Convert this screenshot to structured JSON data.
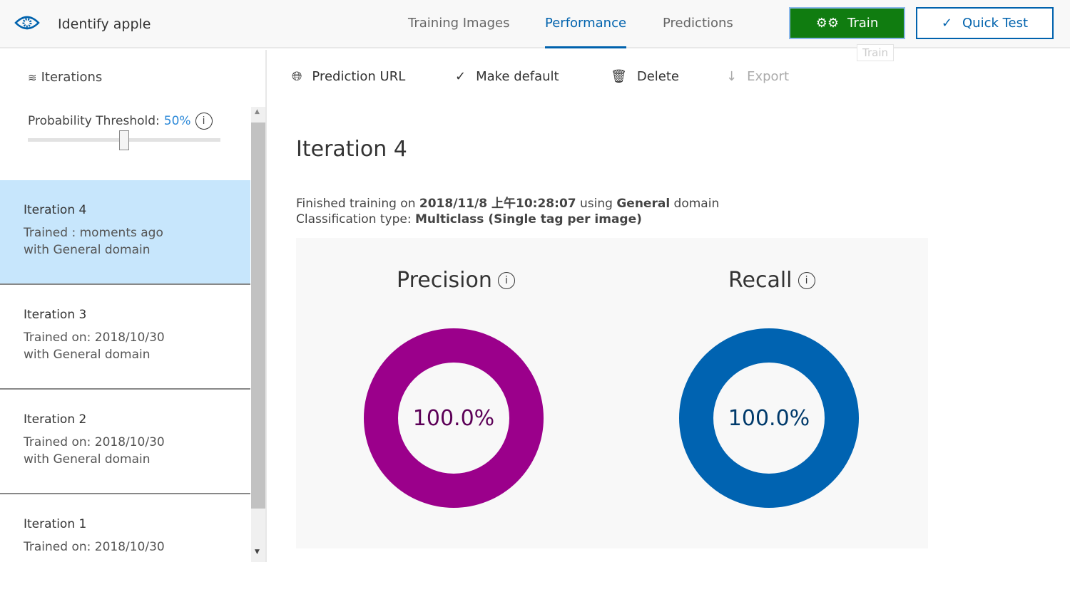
{
  "header": {
    "app_icon": "eye-gear-icon",
    "project_title": "Identify apple",
    "tabs": [
      {
        "label": "Training Images"
      },
      {
        "label": "Performance",
        "active": true
      },
      {
        "label": "Predictions"
      }
    ],
    "train_label": "Train",
    "train_tooltip": "Train",
    "quick_test_label": "Quick Test",
    "brand_color": "#0062ad",
    "train_color": "#107c10"
  },
  "sidebar": {
    "heading": "Iterations",
    "threshold_label": "Probability Threshold:",
    "threshold_value": "50%",
    "threshold_fraction": 0.5,
    "items": [
      {
        "title": "Iteration 4",
        "line1": "Trained : moments ago",
        "line2": "with General domain",
        "selected": true
      },
      {
        "title": "Iteration 3",
        "line1": "Trained on: 2018/10/30",
        "line2": "with General domain"
      },
      {
        "title": "Iteration 2",
        "line1": "Trained on: 2018/10/30",
        "line2": "with General domain"
      },
      {
        "title": "Iteration 1",
        "line1": "Trained on: 2018/10/30",
        "line2": ""
      }
    ]
  },
  "toolbar": {
    "prediction_url": "Prediction URL",
    "make_default": "Make default",
    "delete": "Delete",
    "export": "Export"
  },
  "main": {
    "title": "Iteration 4",
    "finished_prefix": "Finished training on ",
    "finished_date": "2018/11/8 上午10:28:07",
    "finished_mid": " using ",
    "domain": "General",
    "finished_suffix": " domain",
    "class_prefix": "Classification type: ",
    "class_type": "Multiclass (Single tag per image)",
    "precision": {
      "label": "Precision",
      "value": "100.0%",
      "fraction": 1.0,
      "color": "#9b008b"
    },
    "recall": {
      "label": "Recall",
      "value": "100.0%",
      "fraction": 1.0,
      "color": "#0063b1"
    }
  }
}
